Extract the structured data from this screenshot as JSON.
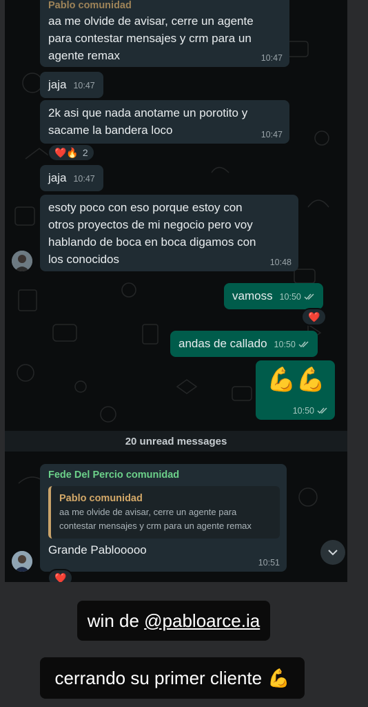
{
  "messages": [
    {
      "id": "m1",
      "sender": "Pablo comunidad",
      "text": "aa me olvide de avisar, cerre un agente\npara contestar mensajes y crm para un\nagente remax",
      "time": "10:47"
    },
    {
      "id": "m2",
      "text": "jaja",
      "time": "10:47"
    },
    {
      "id": "m3",
      "text": "2k asi que nada anotame un porotito y\nsacame la bandera loco",
      "time": "10:47",
      "reaction": {
        "emojis": "❤️🔥",
        "count": "2"
      }
    },
    {
      "id": "m4",
      "text": "jaja",
      "time": "10:47"
    },
    {
      "id": "m5",
      "text": "esoty poco con eso porque estoy con\notros proyectos de mi negocio pero voy\nhablando de boca en boca digamos con\nlos conocidos",
      "time": "10:48"
    },
    {
      "id": "m6",
      "text": "vamoss",
      "time": "10:50",
      "reaction": {
        "emojis": "❤️"
      }
    },
    {
      "id": "m7",
      "text": "andas de callado",
      "time": "10:50"
    },
    {
      "id": "m8",
      "text": "💪💪",
      "time": "10:50"
    },
    {
      "id": "m9",
      "sender": "Fede Del Percio comunidad",
      "quote": {
        "name": "Pablo comunidad",
        "text": "aa me olvide de avisar, cerre un agente para\ncontestar mensajes y crm para un agente remax"
      },
      "text": "Grande Pablooooo",
      "time": "10:51",
      "reaction": {
        "emojis": "❤️"
      }
    }
  ],
  "unread_label": "20 unread messages",
  "captions": {
    "line1_prefix": "win de ",
    "line1_mention": "@pabloarce.ia",
    "line2": "cerrando su primer cliente",
    "line2_emoji": "💪"
  },
  "icons": {
    "read_receipt": "double-check-icon",
    "scroll": "chevron-down-icon"
  },
  "colors": {
    "incoming_bubble": "#202c33",
    "outgoing_bubble": "#005c4b",
    "sender_green": "#53bdeb",
    "sender_fede": "#6cd18a",
    "quote_name": "#d3a868",
    "read_tick": "#a6c7bf"
  }
}
